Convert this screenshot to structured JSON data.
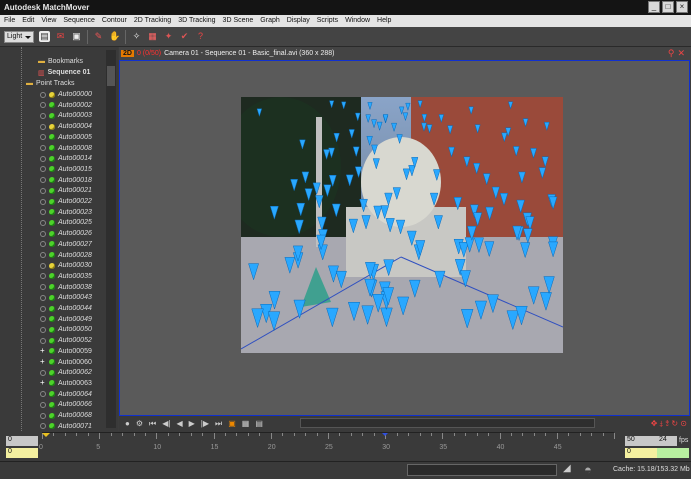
{
  "app": {
    "title": "Autodesk MatchMover"
  },
  "menu": [
    "File",
    "Edit",
    "View",
    "Sequence",
    "Contour",
    "2D Tracking",
    "3D Tracking",
    "3D Scene",
    "Graph",
    "Display",
    "Scripts",
    "Window",
    "Help"
  ],
  "toolbar": {
    "mode_select": "Light"
  },
  "tree": {
    "bookmarks": "Bookmarks",
    "sequence": "Sequence 01",
    "point_tracks": "Point Tracks",
    "tracks": [
      {
        "name": "Auto00000",
        "status": "yellow",
        "state": "ring"
      },
      {
        "name": "Auto00002",
        "status": "green",
        "state": "ring"
      },
      {
        "name": "Auto00003",
        "status": "green",
        "state": "ring"
      },
      {
        "name": "Auto00004",
        "status": "yellow",
        "state": "ring"
      },
      {
        "name": "Auto00005",
        "status": "green",
        "state": "ring"
      },
      {
        "name": "Auto00008",
        "status": "green",
        "state": "ring"
      },
      {
        "name": "Auto00014",
        "status": "green",
        "state": "ring"
      },
      {
        "name": "Auto00015",
        "status": "green",
        "state": "ring"
      },
      {
        "name": "Auto00018",
        "status": "green",
        "state": "ring"
      },
      {
        "name": "Auto00021",
        "status": "green",
        "state": "ring"
      },
      {
        "name": "Auto00022",
        "status": "green",
        "state": "ring"
      },
      {
        "name": "Auto00023",
        "status": "green",
        "state": "ring"
      },
      {
        "name": "Auto00025",
        "status": "green",
        "state": "ring"
      },
      {
        "name": "Auto00026",
        "status": "green",
        "state": "ring"
      },
      {
        "name": "Auto00027",
        "status": "green",
        "state": "ring"
      },
      {
        "name": "Auto00028",
        "status": "green",
        "state": "ring"
      },
      {
        "name": "Auto00030",
        "status": "yellow",
        "state": "ring"
      },
      {
        "name": "Auto00035",
        "status": "green",
        "state": "ring"
      },
      {
        "name": "Auto00038",
        "status": "green",
        "state": "ring"
      },
      {
        "name": "Auto00043",
        "status": "green",
        "state": "ring"
      },
      {
        "name": "Auto00044",
        "status": "green",
        "state": "ring"
      },
      {
        "name": "Auto00049",
        "status": "green",
        "state": "ring"
      },
      {
        "name": "Auto00050",
        "status": "green",
        "state": "ring"
      },
      {
        "name": "Auto00052",
        "status": "green",
        "state": "ring"
      },
      {
        "name": "Auto00059",
        "status": "green",
        "state": "plus"
      },
      {
        "name": "Auto00060",
        "status": "green",
        "state": "plus"
      },
      {
        "name": "Auto00062",
        "status": "green",
        "state": "ring"
      },
      {
        "name": "Auto00063",
        "status": "green",
        "state": "plus"
      },
      {
        "name": "Auto00064",
        "status": "green",
        "state": "ring"
      },
      {
        "name": "Auto00066",
        "status": "green",
        "state": "ring"
      },
      {
        "name": "Auto00068",
        "status": "green",
        "state": "ring"
      },
      {
        "name": "Auto00071",
        "status": "green",
        "state": "ring"
      }
    ]
  },
  "view": {
    "badge": "2D",
    "frame": "0 (0/50)",
    "header_text": "Camera 01 - Sequence 01 - Basic_final.avi (360 x 288)"
  },
  "timeline": {
    "start_top": "0",
    "start_bottom": "0",
    "end_top": "50",
    "end_bottom": "0",
    "fps_value": "24",
    "fps_label": "fps",
    "ticks": [
      "0",
      "5",
      "10",
      "15",
      "20",
      "25",
      "30",
      "35",
      "40",
      "45"
    ]
  },
  "status": {
    "cache": "Cache: 15.18/153.32 Mb"
  },
  "colors": {
    "accent": "#1030d0",
    "track_cone": "#29a8ff",
    "tracked_green": "#4dd32a",
    "tracked_yellow": "#e6d33a"
  }
}
